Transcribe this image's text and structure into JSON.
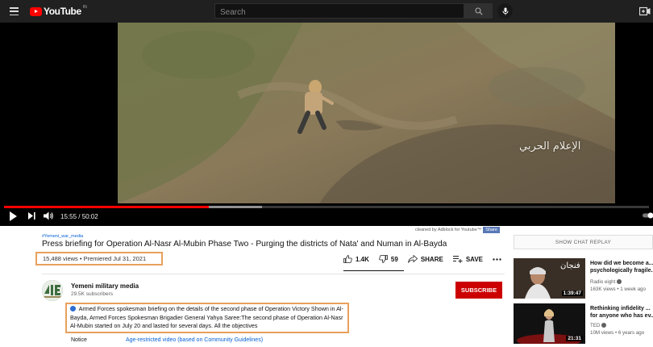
{
  "app": {
    "logo_text": "YouTube",
    "region": "IN"
  },
  "search": {
    "placeholder": "Search"
  },
  "player": {
    "time": "15:55 / 50:02",
    "progress_played": 0.318,
    "progress_loaded": 0.4,
    "watermark": "الإعلام الحربي"
  },
  "attribution": {
    "text": "cleaned by Adblock for Youtube™",
    "share_label": "Share"
  },
  "video": {
    "hashtag": "#Yemeni_war_media",
    "title": "Press briefing for Operation Al-Nasr Al-Mubin Phase Two - Purging the districts of Nata' and Numan in Al-Bayda",
    "views": "15,488 views • Premiered Jul 31, 2021",
    "likes": "1.4K",
    "dislikes": "59",
    "share_label": "SHARE",
    "save_label": "SAVE"
  },
  "channel": {
    "name": "Yemeni military media",
    "subscribers": "29.5K subscribers",
    "subscribe_label": "SUBSCRIBE"
  },
  "description": {
    "text": "Armed Forces spokesman briefing on the details of the second phase of Operation Victory Shown in Al-Bayda, Armed Forces Spokesman Brigadier General Yahya Saree:The second phase of Operation Al-Nasr Al-Mubin started on July 20 and lasted for several days. All the objectives",
    "notice_label": "Notice",
    "notice_link": "Age-restricted video (based on Community Guidelines)"
  },
  "sidebar": {
    "chat_replay_label": "SHOW CHAT REPLAY",
    "recommendations": [
      {
        "title": "How did we become a...",
        "title2": "psychologically fragile...",
        "channel": "Radio eight",
        "meta": "163K views • 1 week ago",
        "duration": "1:39:47",
        "thumb_text": "فنجان"
      },
      {
        "title": "Rethinking infidelity ...",
        "title2": "for anyone who has ev...",
        "channel": "TED",
        "meta": "10M views • 6 years ago",
        "duration": "21:31"
      }
    ]
  },
  "colors": {
    "accent": "#ff0000",
    "subscribe": "#cc0000",
    "link": "#065fd4",
    "highlight_box": "#e8a05c"
  }
}
